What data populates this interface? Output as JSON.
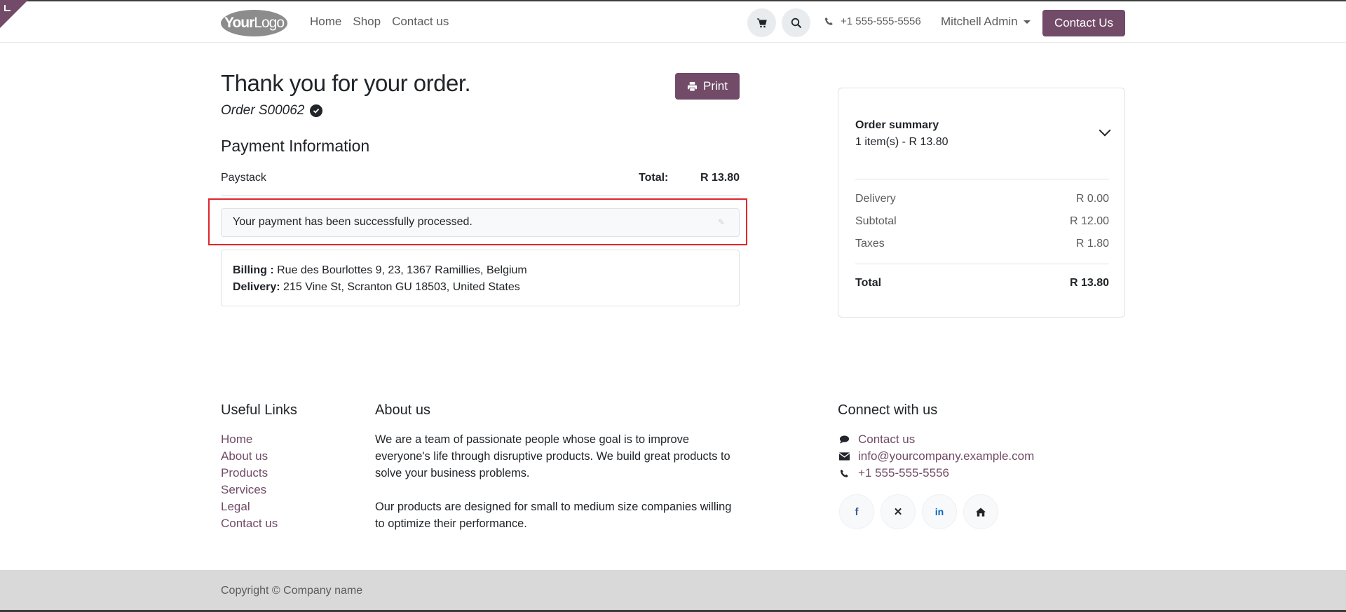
{
  "header": {
    "logo_text_bold": "Your",
    "logo_text_light": "Logo",
    "nav": [
      "Home",
      "Shop",
      "Contact us"
    ],
    "phone": "+1 555-555-5556",
    "user": "Mitchell Admin",
    "contact_button": "Contact Us"
  },
  "main": {
    "title": "Thank you for your order.",
    "order_ref": "Order S00062",
    "print_label": "Print",
    "payment_title": "Payment Information",
    "payment_method": "Paystack",
    "total_label": "Total:",
    "total_value": "R 13.80",
    "alert": "Your payment has been successfully processed.",
    "billing_label": "Billing :",
    "billing_address": "Rue des Bourlottes 9, 23, 1367 Ramillies, Belgium",
    "delivery_label": "Delivery:",
    "delivery_address": "215 Vine St, Scranton GU 18503, United States"
  },
  "summary": {
    "title": "Order summary",
    "items": "1 item(s) -  R 13.80",
    "rows": [
      {
        "label": "Delivery",
        "value": "R 0.00"
      },
      {
        "label": "Subtotal",
        "value": "R 12.00"
      },
      {
        "label": "Taxes",
        "value": "R 1.80"
      }
    ],
    "total_label": "Total",
    "total_value": "R 13.80"
  },
  "footer": {
    "links_title": "Useful Links",
    "links": [
      "Home",
      "About us",
      "Products",
      "Services",
      "Legal",
      "Contact us"
    ],
    "about_title": "About us",
    "about_p1": "We are a team of passionate people whose goal is to improve everyone's life through disruptive products. We build great products to solve your business problems.",
    "about_p2": "Our products are designed for small to medium size companies willing to optimize their performance.",
    "connect_title": "Connect with us",
    "connect": {
      "contact": "Contact us",
      "email": "info@yourcompany.example.com",
      "phone": "+1 555-555-5556"
    },
    "social": [
      "facebook-icon",
      "x-icon",
      "linkedin-icon",
      "home-icon"
    ],
    "copyright": "Copyright © Company name"
  },
  "colors": {
    "brand": "#714b67",
    "highlight": "#e0262b"
  }
}
